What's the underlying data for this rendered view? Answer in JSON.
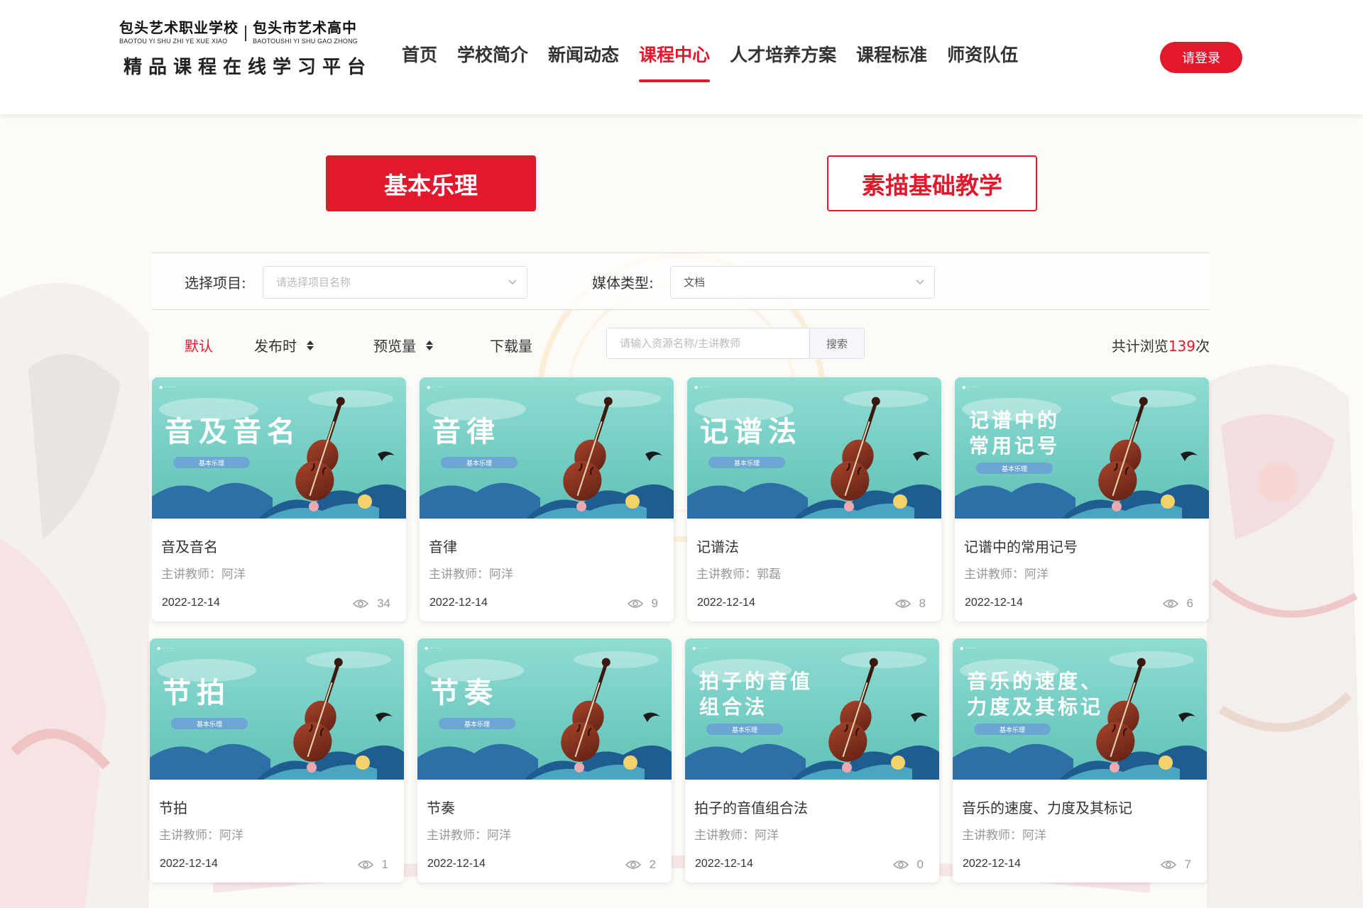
{
  "header": {
    "logo": {
      "school_left_cn": "包头艺术职业学校",
      "school_left_py": "BAOTOU YI SHU ZHI YE XUE XIAO",
      "school_right_cn": "包头市艺术高中",
      "school_right_py": "BAOTOUSHI YI SHU GAO ZHONG",
      "platform_title": "精品课程在线学习平台"
    },
    "nav": [
      {
        "label": "首页"
      },
      {
        "label": "学校简介"
      },
      {
        "label": "新闻动态"
      },
      {
        "label": "课程中心",
        "active": true
      },
      {
        "label": "人才培养方案"
      },
      {
        "label": "课程标准"
      },
      {
        "label": "师资队伍"
      }
    ],
    "login_label": "请登录"
  },
  "categories": [
    {
      "label": "基本乐理",
      "active": true
    },
    {
      "label": "素描基础教学",
      "active": false
    }
  ],
  "filters": {
    "project_label": "选择项目:",
    "project_placeholder": "请选择项目名称",
    "media_label": "媒体类型:",
    "media_value": "文档"
  },
  "sort": {
    "default_label": "默认",
    "publish_label": "发布时",
    "preview_label": "预览量",
    "download_label": "下载量",
    "search_placeholder": "请输入资源名称/主讲教师",
    "search_button": "搜索",
    "total_prefix": "共计浏览",
    "total_count": "139",
    "total_suffix": "次"
  },
  "cards": [
    {
      "title": "音及音名",
      "thumb_lines": [
        "音及音名"
      ],
      "teacher": "主讲教师：阿洋",
      "date": "2022-12-14",
      "views": "34"
    },
    {
      "title": "音律",
      "thumb_lines": [
        "音律"
      ],
      "teacher": "主讲教师：阿洋",
      "date": "2022-12-14",
      "views": "9"
    },
    {
      "title": "记谱法",
      "thumb_lines": [
        "记谱法"
      ],
      "teacher": "主讲教师：郭磊",
      "date": "2022-12-14",
      "views": "8"
    },
    {
      "title": "记谱中的常用记号",
      "thumb_lines": [
        "记谱中的",
        "常用记号"
      ],
      "teacher": "主讲教师：阿洋",
      "date": "2022-12-14",
      "views": "6"
    },
    {
      "title": "节拍",
      "thumb_lines": [
        "节拍"
      ],
      "teacher": "主讲教师：阿洋",
      "date": "2022-12-14",
      "views": "1"
    },
    {
      "title": "节奏",
      "thumb_lines": [
        "节奏"
      ],
      "teacher": "主讲教师：阿洋",
      "date": "2022-12-14",
      "views": "2"
    },
    {
      "title": "拍子的音值组合法",
      "thumb_lines": [
        "拍子的音值",
        "组合法"
      ],
      "teacher": "主讲教师：阿洋",
      "date": "2022-12-14",
      "views": "0"
    },
    {
      "title": "音乐的速度、力度及其标记",
      "thumb_lines": [
        "音乐的速度、",
        "力度及其标记"
      ],
      "teacher": "主讲教师：阿洋",
      "date": "2022-12-14",
      "views": "7"
    }
  ],
  "thumb_subtitle": "基本乐理",
  "colors": {
    "accent": "#e2192c",
    "thumb_sky": "#7fd3c9",
    "cello": "#8b3a28"
  }
}
